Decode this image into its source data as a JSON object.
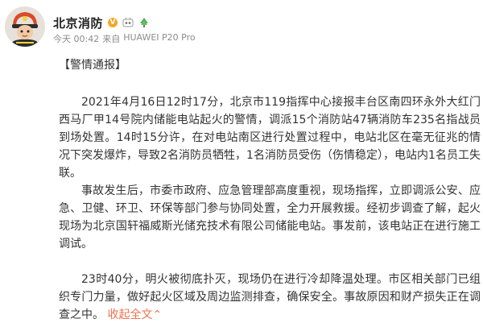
{
  "post": {
    "account_name": "北京消防",
    "time": "今天 00:42",
    "source_prefix": "来自",
    "device": "HUAWEI P20 Pro",
    "section_tag": "【警情通报】",
    "paragraphs": [
      "2021年4月16日12时17分，北京市119指挥中心接报丰台区南四环永外大红门西马厂甲14号院内储能电站起火的警情，调派15个消防站47辆消防车235名指战员到场处置。14时15分许，在对电站南区进行处置过程中，电站北区在毫无征兆的情况下突发爆炸，导致2名消防员牺牲，1名消防员受伤（伤情稳定），电站内1名员工失联。",
      "事故发生后，市委市政府、应急管理部高度重视，现场指挥，立即调派公安、应急、卫健、环卫、环保等部门参与协同处置，全力开展救援。经初步调查了解，起火现场为北京国轩福威斯光储充技术有限公司储能电站。事发前，该电站正在进行施工调试。",
      "23时40分，明火被彻底扑灭，现场仍在进行冷却降温处理。市区相关部门已组织专门力量，做好起火区域及周边监测排查，确保安全。事故原因和财产损失正在调查之中。"
    ],
    "expand_link": "收起全文",
    "expand_arrow": "⌃"
  },
  "icons": {
    "verified": "verified-badge-icon",
    "vip": "vip-icon",
    "tree": "tree-icon",
    "avatar": "firefighter-avatar"
  },
  "colors": {
    "link": "#eb7350",
    "meta": "#8c8c8c",
    "verified": "#f5a623"
  }
}
